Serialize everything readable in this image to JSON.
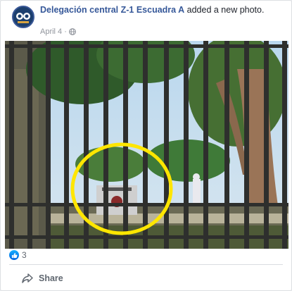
{
  "post": {
    "author": "Delegación central Z-1 Escuadra A",
    "action": " added a new photo.",
    "date": "April 4",
    "separator": "·",
    "privacy_icon": "globe-icon"
  },
  "reactions": {
    "icon": "like-icon",
    "count": "3"
  },
  "actions": {
    "share_label": "Share",
    "share_icon": "share-arrow-icon"
  },
  "photo": {
    "highlight_color": "#ffe600"
  },
  "colors": {
    "author_link": "#365899",
    "meta": "#90949c",
    "like_badge": "#1877f2"
  }
}
